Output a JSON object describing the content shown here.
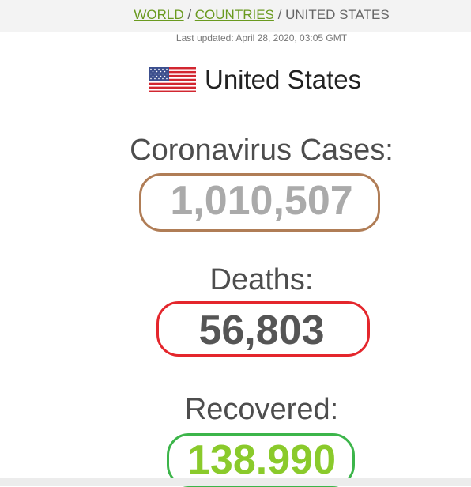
{
  "breadcrumb": {
    "world": "WORLD",
    "sep1": " / ",
    "countries": "COUNTRIES",
    "sep2": " / ",
    "current": "UNITED STATES"
  },
  "last_updated": "Last updated: April 28, 2020, 03:05 GMT",
  "country": {
    "name": "United States",
    "flag_icon": "us-flag-icon"
  },
  "stats": {
    "cases_label": "Coronavirus Cases:",
    "cases_value": "1,010,507",
    "deaths_label": "Deaths:",
    "deaths_value": "56,803",
    "recovered_label": "Recovered:",
    "recovered_value": "138.990"
  },
  "colors": {
    "link": "#6a9a1f",
    "cases_value": "#aaaaaa",
    "deaths_value": "#555555",
    "recovered_value": "#8aca2b",
    "cases_ring": "#b07d56",
    "deaths_ring": "#e4262c",
    "recovered_ring": "#3cb54a"
  }
}
